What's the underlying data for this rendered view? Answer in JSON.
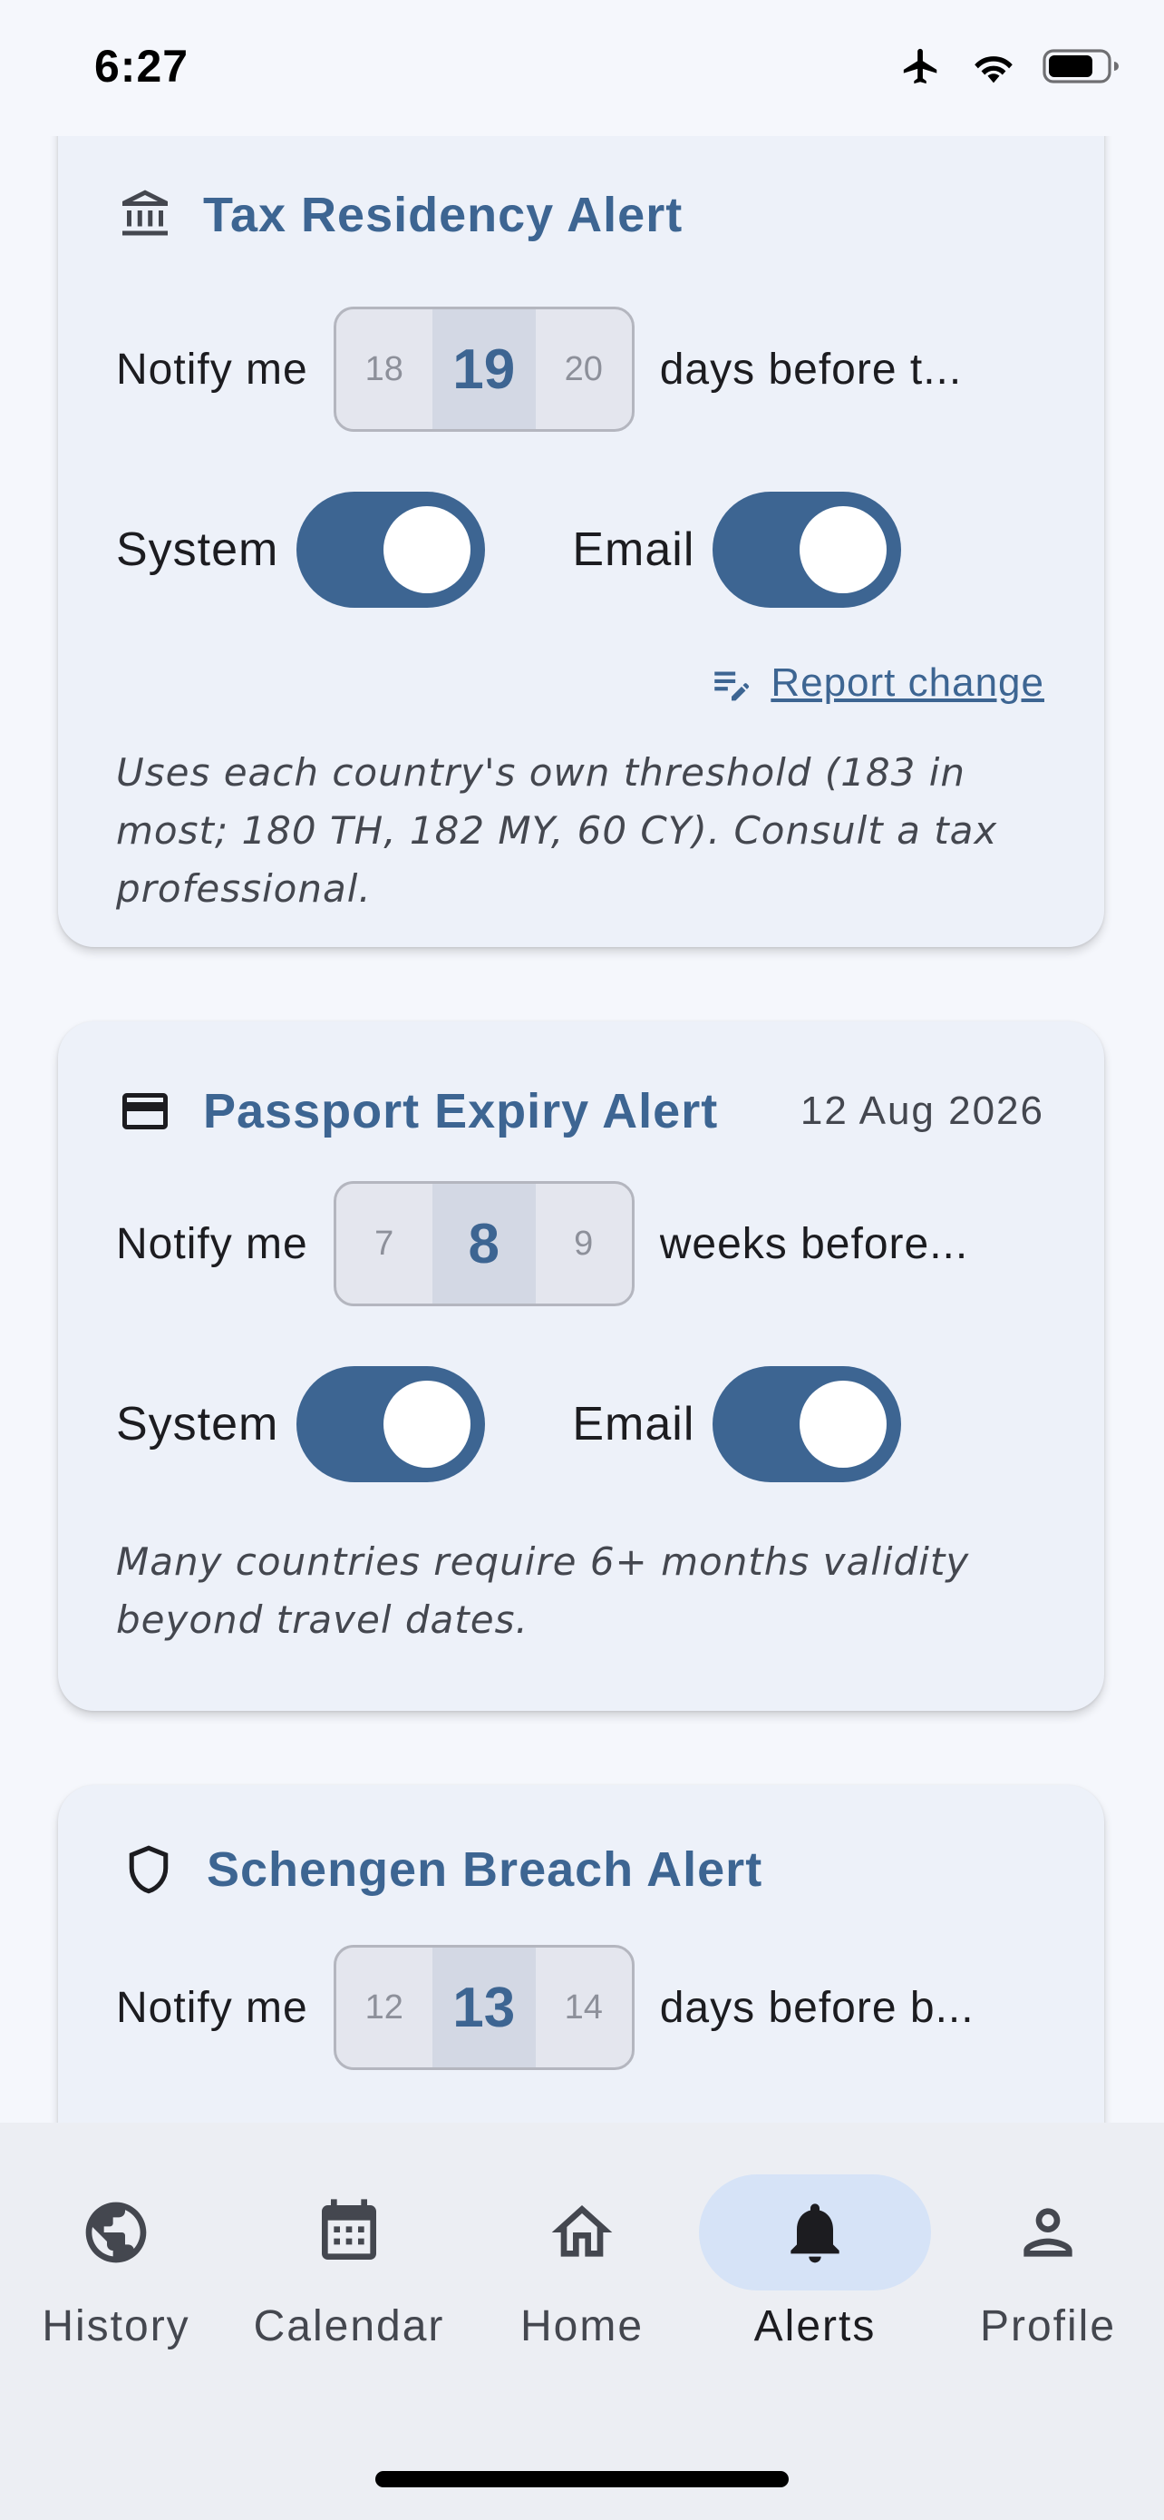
{
  "status": {
    "time": "6:27",
    "icons": [
      "airplane-icon",
      "wifi-icon",
      "battery-icon"
    ]
  },
  "cards": [
    {
      "title": "Tax Residency Alert",
      "icon": "bank-icon",
      "notify_label": "Notify me",
      "picker": {
        "prev": "18",
        "value": "19",
        "next": "20"
      },
      "suffix": "days before t...",
      "toggles": [
        {
          "label": "System",
          "on": true
        },
        {
          "label": "Email",
          "on": true
        }
      ],
      "report_link": "Report change",
      "note": "Uses each country's own threshold (183 in most; 180 TH, 182 MY, 60 CY). Consult a tax professional."
    },
    {
      "title": "Passport Expiry Alert",
      "date": "12 Aug 2026",
      "icon": "passport-card-icon",
      "notify_label": "Notify me",
      "picker": {
        "prev": "7",
        "value": "8",
        "next": "9"
      },
      "suffix": "weeks before...",
      "toggles": [
        {
          "label": "System",
          "on": true
        },
        {
          "label": "Email",
          "on": true
        }
      ],
      "note": "Many countries require 6+ months validity beyond travel dates."
    },
    {
      "title": "Schengen Breach Alert",
      "icon": "shield-icon",
      "notify_label": "Notify me",
      "picker": {
        "prev": "12",
        "value": "13",
        "next": "14"
      },
      "suffix": "days before b..."
    }
  ],
  "nav": {
    "items": [
      {
        "label": "History",
        "icon": "globe-icon"
      },
      {
        "label": "Calendar",
        "icon": "calendar-icon"
      },
      {
        "label": "Home",
        "icon": "home-icon"
      },
      {
        "label": "Alerts",
        "icon": "bell-icon",
        "active": true
      },
      {
        "label": "Profile",
        "icon": "person-icon"
      }
    ]
  },
  "colors": {
    "accent": "#3d6592",
    "card_bg": "#edf1f9",
    "page_bg": "#f5f7fc",
    "nav_bg": "#eceef3",
    "nav_active_pill": "#d6e3f7"
  }
}
